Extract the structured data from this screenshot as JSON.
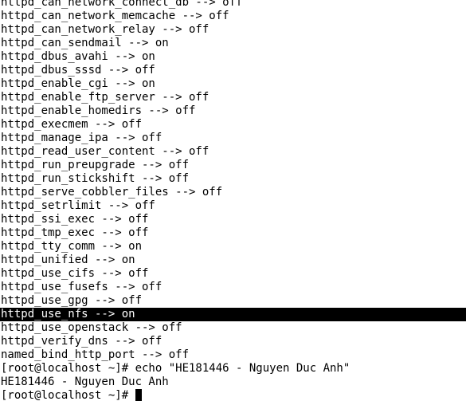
{
  "terminal": {
    "lines": [
      "httpd_can_network_connect_db --> off",
      "httpd_can_network_memcache --> off",
      "httpd_can_network_relay --> off",
      "httpd_can_sendmail --> on",
      "httpd_dbus_avahi --> on",
      "httpd_dbus_sssd --> off",
      "httpd_enable_cgi --> on",
      "httpd_enable_ftp_server --> off",
      "httpd_enable_homedirs --> off",
      "httpd_execmem --> off",
      "httpd_manage_ipa --> off",
      "httpd_read_user_content --> off",
      "httpd_run_preupgrade --> off",
      "httpd_run_stickshift --> off",
      "httpd_serve_cobbler_files --> off",
      "httpd_setrlimit --> off",
      "httpd_ssi_exec --> off",
      "httpd_tmp_exec --> off",
      "httpd_tty_comm --> on",
      "httpd_unified --> on",
      "httpd_use_cifs --> off",
      "httpd_use_fusefs --> off",
      "httpd_use_gpg --> off",
      "httpd_use_nfs --> on",
      "httpd_use_openstack --> off",
      "httpd_verify_dns --> off",
      "named_bind_http_port --> off",
      "[root@localhost ~]# echo \"HE181446 - Nguyen Duc Anh\"",
      "HE181446 - Nguyen Duc Anh"
    ],
    "prompt": "[root@localhost ~]# "
  }
}
